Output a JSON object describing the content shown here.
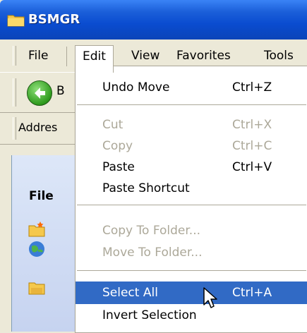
{
  "window": {
    "title": "BSMGR"
  },
  "menubar": {
    "items": [
      {
        "label": "File"
      },
      {
        "label": "Edit"
      },
      {
        "label": "View"
      },
      {
        "label": "Favorites"
      },
      {
        "label": "Tools"
      }
    ]
  },
  "toolbar": {
    "back_label": "B"
  },
  "address": {
    "label": "Addres"
  },
  "content": {
    "files_header": "File"
  },
  "edit_menu": {
    "items": [
      {
        "label": "Undo Move",
        "shortcut": "Ctrl+Z",
        "state": "enabled"
      },
      {
        "label": "Cut",
        "shortcut": "Ctrl+X",
        "state": "disabled"
      },
      {
        "label": "Copy",
        "shortcut": "Ctrl+C",
        "state": "disabled"
      },
      {
        "label": "Paste",
        "shortcut": "Ctrl+V",
        "state": "enabled"
      },
      {
        "label": "Paste Shortcut",
        "shortcut": "",
        "state": "enabled"
      },
      {
        "label": "Copy To Folder...",
        "shortcut": "",
        "state": "disabled"
      },
      {
        "label": "Move To Folder...",
        "shortcut": "",
        "state": "disabled"
      },
      {
        "label": "Select All",
        "shortcut": "Ctrl+A",
        "state": "selected"
      },
      {
        "label": "Invert Selection",
        "shortcut": "",
        "state": "enabled"
      }
    ]
  },
  "colors": {
    "titlebar": "#0a4cd0",
    "highlight": "#316ac5",
    "disabled_text": "#aca899"
  }
}
